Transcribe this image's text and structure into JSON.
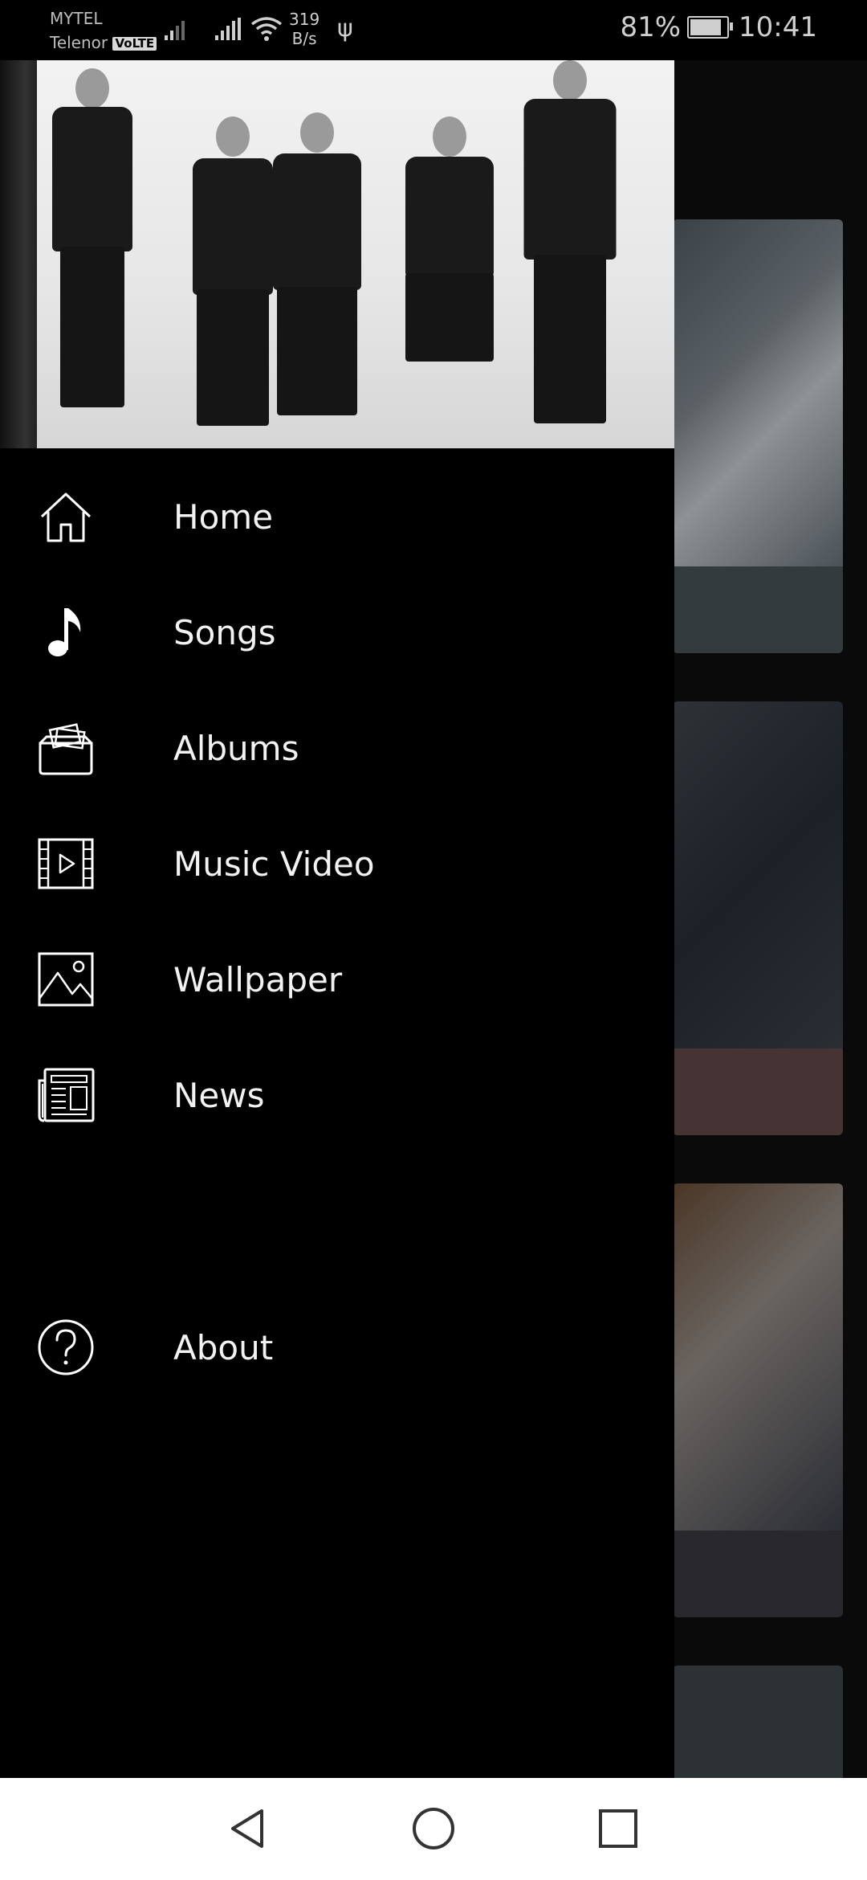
{
  "status_bar": {
    "carrier1": "MYTEL",
    "carrier2": "Telenor",
    "volte_badge": "VoLTE",
    "speed_value": "319",
    "speed_unit": "B/s",
    "battery_percent": "81%",
    "time": "10:41"
  },
  "drawer": {
    "header_image": "band-photo",
    "menu_items": [
      {
        "label": "Home",
        "icon": "home-icon"
      },
      {
        "label": "Songs",
        "icon": "music-note-icon"
      },
      {
        "label": "Albums",
        "icon": "albums-icon"
      },
      {
        "label": "Music Video",
        "icon": "video-icon"
      },
      {
        "label": "Wallpaper",
        "icon": "image-icon"
      },
      {
        "label": "News",
        "icon": "newspaper-icon"
      },
      {
        "label": "About",
        "icon": "help-icon"
      }
    ]
  },
  "navigation_bar": {
    "back": "back-icon",
    "home": "home-circle-icon",
    "recents": "recents-icon"
  },
  "colors": {
    "drawer_bg": "#000000",
    "text": "#f2f2f2",
    "nav_bg": "#ffffff"
  }
}
